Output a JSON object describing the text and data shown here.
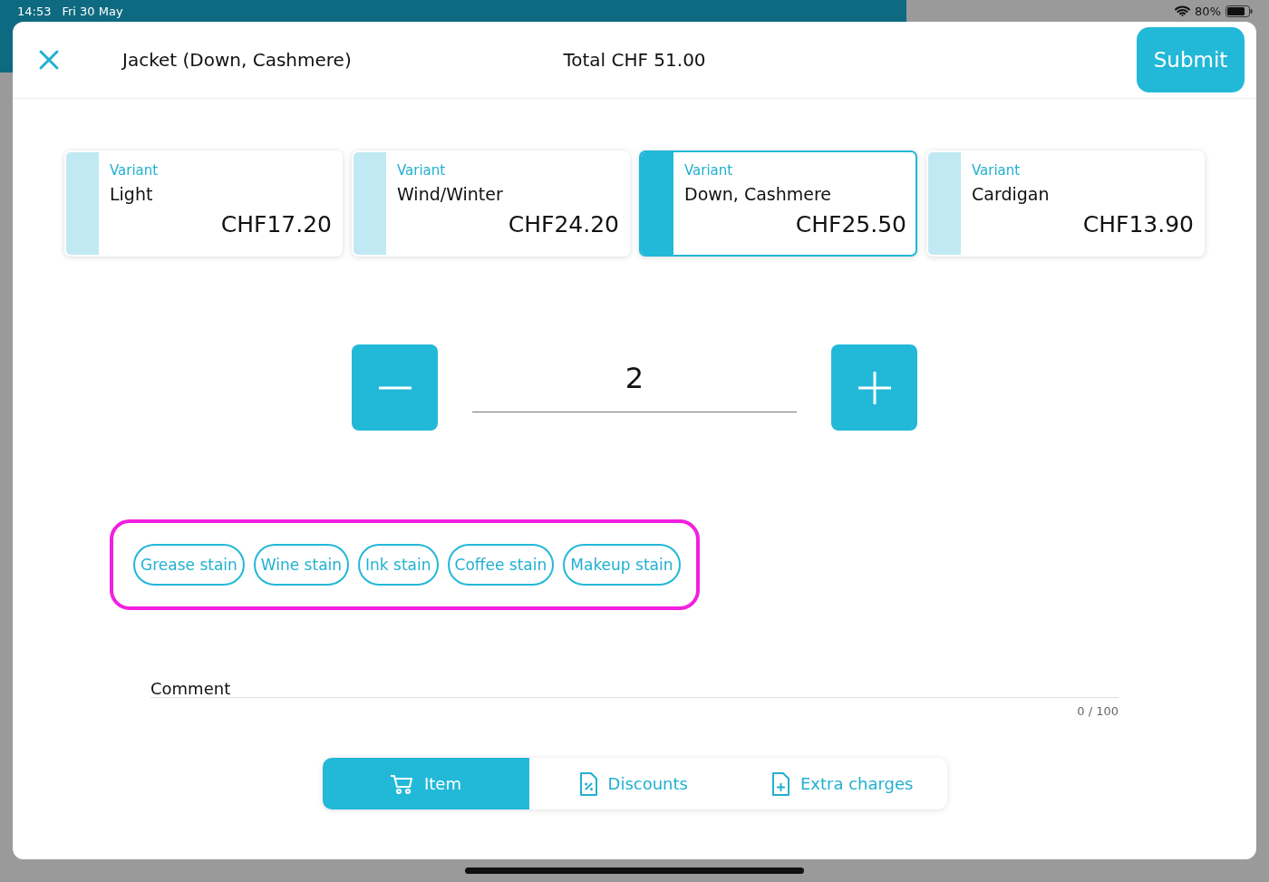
{
  "status_bar": {
    "time": "14:53",
    "date": "Fri 30 May",
    "battery": "80%"
  },
  "header": {
    "title": "Jacket (Down, Cashmere)",
    "total": "Total CHF 51.00",
    "submit": "Submit"
  },
  "variants": [
    {
      "caption": "Variant",
      "name": "Light",
      "price": "CHF17.20",
      "selected": false
    },
    {
      "caption": "Variant",
      "name": "Wind/Winter",
      "price": "CHF24.20",
      "selected": false
    },
    {
      "caption": "Variant",
      "name": "Down, Cashmere",
      "price": "CHF25.50",
      "selected": true
    },
    {
      "caption": "Variant",
      "name": "Cardigan",
      "price": "CHF13.90",
      "selected": false
    }
  ],
  "quantity": "2",
  "stains": [
    {
      "label": "Grease stain"
    },
    {
      "label": "Wine stain"
    },
    {
      "label": "Ink stain"
    },
    {
      "label": "Coffee stain"
    },
    {
      "label": "Makeup stain"
    }
  ],
  "comment": {
    "label": "Comment",
    "counter": "0 / 100"
  },
  "tabs": [
    {
      "label": "Item",
      "kind": "cart",
      "selected": true
    },
    {
      "label": "Discounts",
      "kind": "discount",
      "selected": false
    },
    {
      "label": "Extra charges",
      "kind": "add",
      "selected": false
    }
  ]
}
